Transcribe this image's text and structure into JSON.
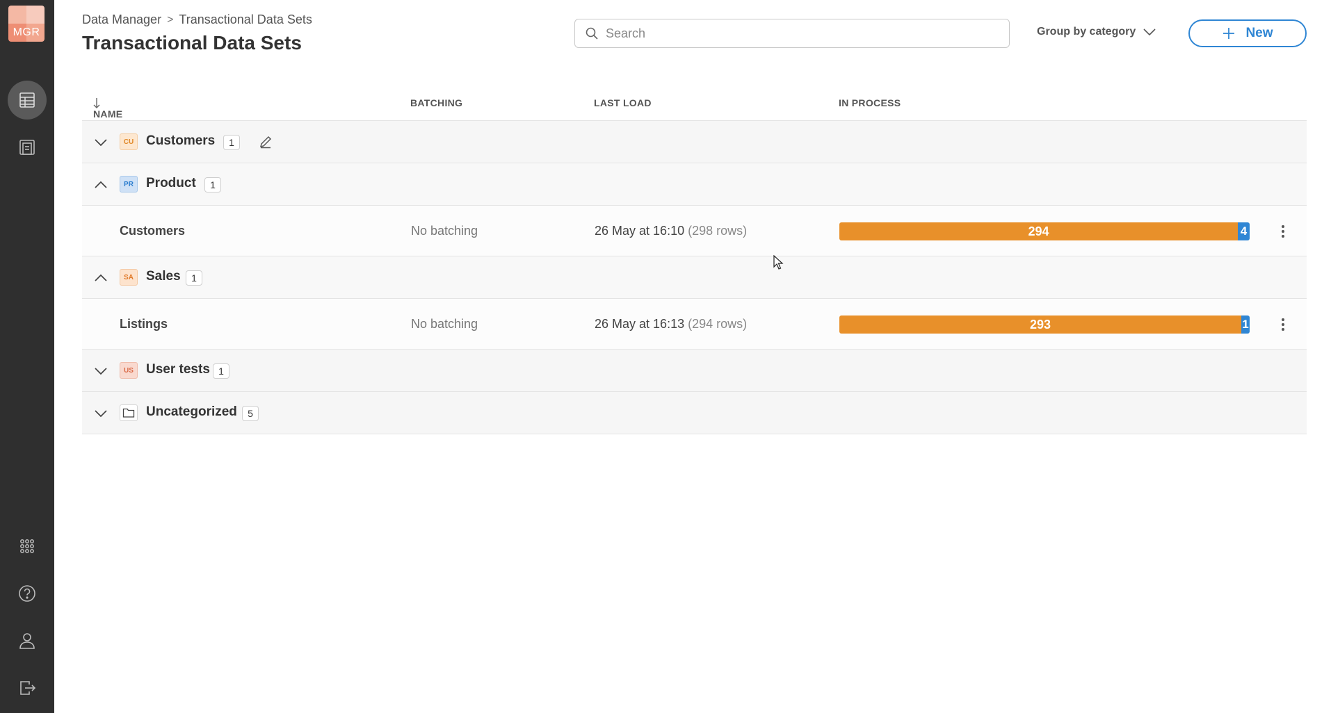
{
  "sidebar": {
    "logo_text": "MGR",
    "items": [
      {
        "icon": "table-icon",
        "active": true
      },
      {
        "icon": "pages-icon",
        "active": false
      }
    ],
    "bottom_items": [
      {
        "icon": "apps-grid-icon"
      },
      {
        "icon": "help-icon"
      },
      {
        "icon": "user-icon"
      },
      {
        "icon": "logout-icon"
      }
    ]
  },
  "breadcrumb": {
    "root": "Data Manager",
    "separator": ">",
    "current": "Transactional Data Sets"
  },
  "page_title": "Transactional Data Sets",
  "search": {
    "placeholder": "Search",
    "value": ""
  },
  "group_by": {
    "label": "Group by category"
  },
  "new_button": {
    "label": "New"
  },
  "table": {
    "columns": {
      "name": "NAME",
      "batching": "BATCHING",
      "last_load": "LAST LOAD",
      "in_process": "IN PROCESS"
    },
    "categories": [
      {
        "badge": "CU",
        "badge_bg": "#fde7cf",
        "badge_color": "#e0892a",
        "name": "Customers",
        "count": "1",
        "expanded": false,
        "editable": true
      },
      {
        "badge": "PR",
        "badge_bg": "#cfe1f6",
        "badge_color": "#2f7fcf",
        "name": "Product",
        "count": "1",
        "expanded": true,
        "rows": [
          {
            "name": "Customers",
            "batching": "No batching",
            "last_load": "26 May at 16:10",
            "rows": "(298 rows)",
            "in_process": "294",
            "queued": "4"
          }
        ]
      },
      {
        "badge": "SA",
        "badge_bg": "#fde3cd",
        "badge_color": "#e07a2a",
        "name": "Sales",
        "count": "1",
        "expanded": true,
        "rows": [
          {
            "name": "Listings",
            "batching": "No batching",
            "last_load": "26 May at 16:13",
            "rows": "(294 rows)",
            "in_process": "293",
            "queued": "1"
          }
        ]
      },
      {
        "badge": "US",
        "badge_bg": "#f9d9cf",
        "badge_color": "#d96a48",
        "name": "User tests",
        "count": "1",
        "expanded": false
      },
      {
        "badge": "",
        "icon": "folder-icon",
        "name": "Uncategorized",
        "count": "5",
        "expanded": false
      }
    ]
  },
  "colors": {
    "accent": "#2f86d4",
    "in_process": "#e8902a",
    "sidebar": "#2f2f2f"
  }
}
